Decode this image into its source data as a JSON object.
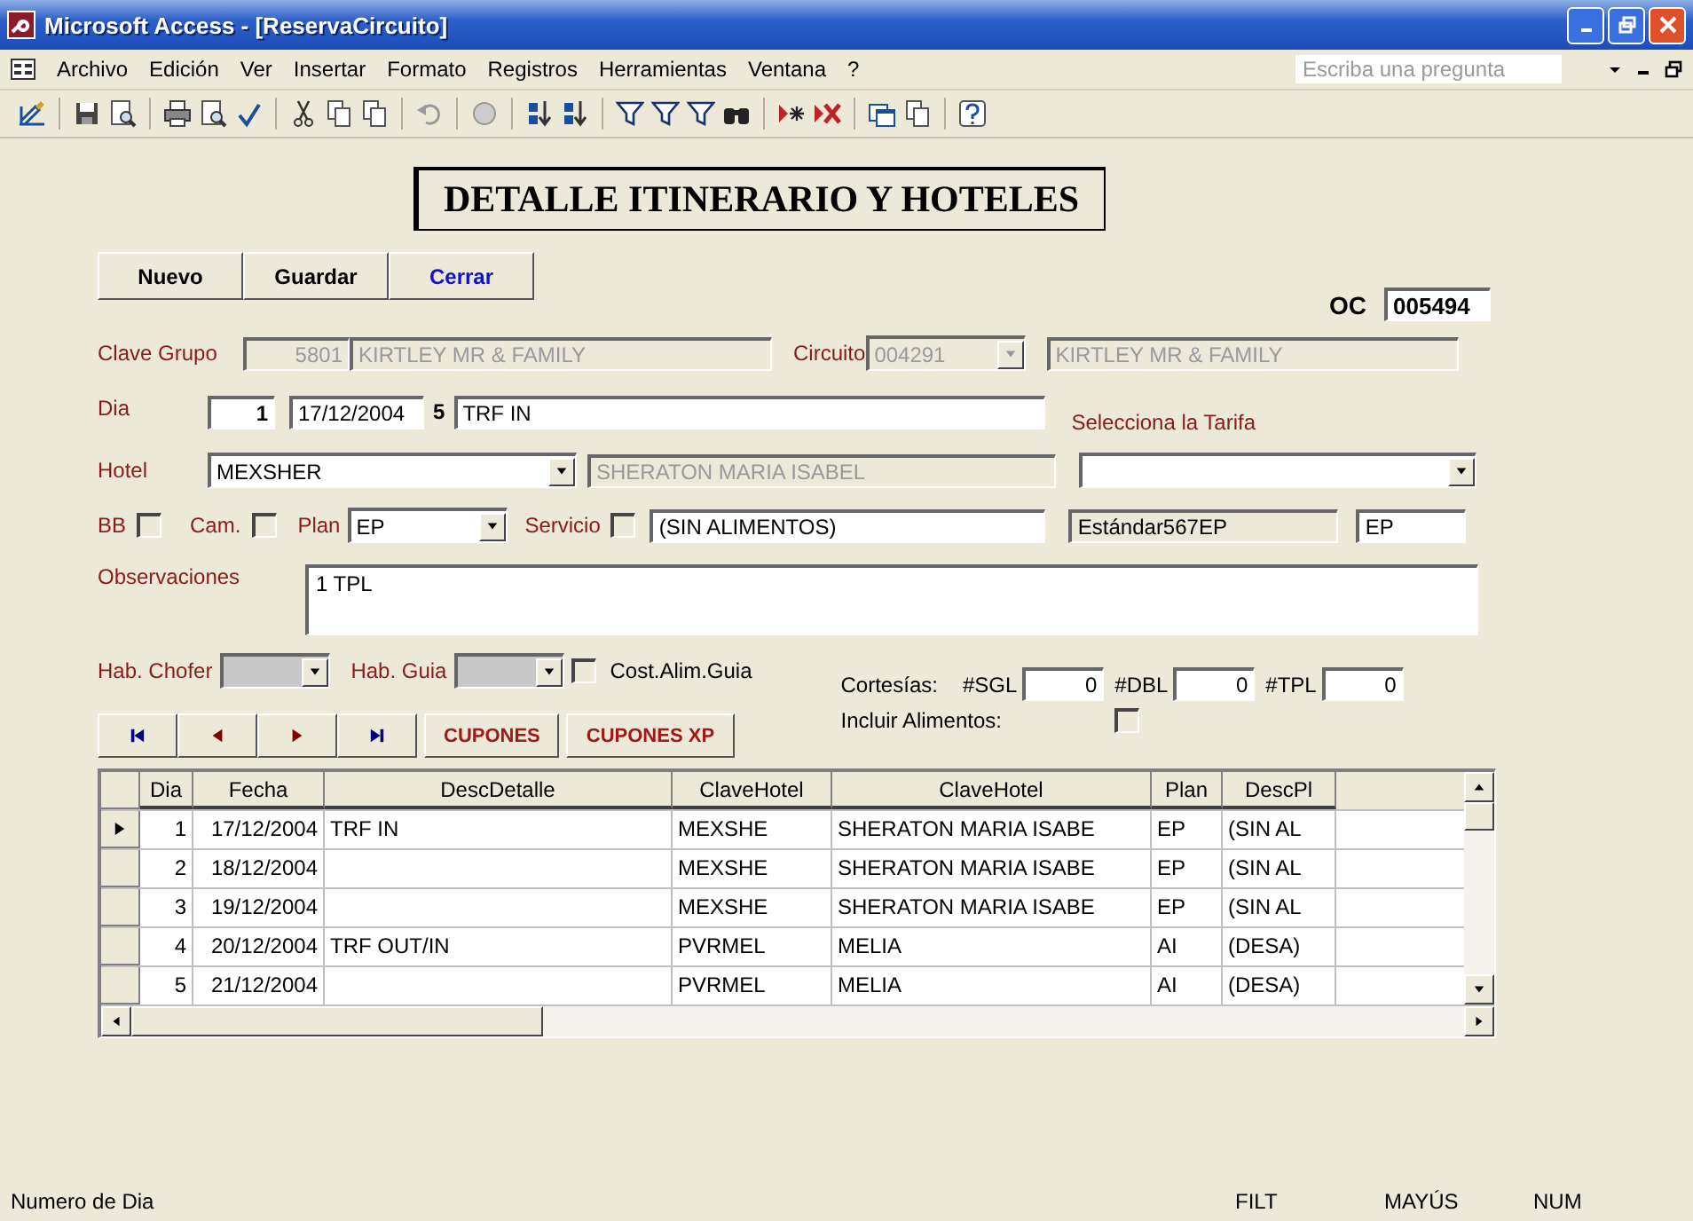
{
  "window": {
    "title": "Microsoft Access - [ReservaCircuito]"
  },
  "menu": [
    "Archivo",
    "Edición",
    "Ver",
    "Insertar",
    "Formato",
    "Registros",
    "Herramientas",
    "Ventana",
    "?"
  ],
  "help_search": {
    "placeholder": "Escriba una pregunta"
  },
  "form": {
    "heading": "DETALLE ITINERARIO Y HOTELES",
    "buttons": [
      "Nuevo",
      "Guardar",
      "Cerrar"
    ],
    "oc": {
      "label": "OC",
      "value": "005494"
    },
    "clave_grupo": {
      "label": "Clave Grupo",
      "code": "5801",
      "name": "KIRTLEY MR & FAMILY",
      "disabled": true
    },
    "circuito": {
      "label": "Circuito",
      "code": "004291",
      "name": "KIRTLEY MR & FAMILY",
      "disabled": true
    },
    "dia": {
      "label": "Dia",
      "number": "1",
      "date": "17/12/2004",
      "weekday": "5",
      "description": "TRF IN"
    },
    "tarifa_label": "Selecciona la Tarifa",
    "hotel": {
      "label": "Hotel",
      "code": "MEXSHER",
      "name": "SHERATON MARIA ISABEL",
      "disabled": true
    },
    "bb": {
      "label": "BB",
      "checked": false
    },
    "cam": {
      "label": "Cam.",
      "checked": false
    },
    "plan": {
      "label": "Plan",
      "value": "EP"
    },
    "servicio": {
      "label": "Servicio",
      "checked": false,
      "value": "(SIN ALIMENTOS)"
    },
    "tarifa_name": "Estándar567EP",
    "tarifa_plan": "EP",
    "observaciones": {
      "label": "Observaciones",
      "value": "1 TPL"
    },
    "hab_chofer": {
      "label": "Hab. Chofer"
    },
    "hab_guia": {
      "label": "Hab. Guia"
    },
    "cost_alim": {
      "label": "Cost.Alim.Guia",
      "checked": false
    },
    "cortesias": {
      "label": "Cortesías:",
      "items": [
        {
          "label": "#SGL",
          "value": "0"
        },
        {
          "label": "#DBL",
          "value": "0"
        },
        {
          "label": "#TPL",
          "value": "0"
        }
      ]
    },
    "incluir": {
      "label": "Incluir Alimentos:",
      "checked": false
    },
    "extra_buttons": [
      "CUPONES",
      "CUPONES XP"
    ]
  },
  "table": {
    "columns": [
      "Dia",
      "Fecha",
      "DescDetalle",
      "ClaveHotel",
      "ClaveHotel",
      "Plan",
      "DescPl"
    ],
    "rows": [
      {
        "selected": true,
        "cells": [
          "1",
          "17/12/2004",
          "TRF IN",
          "MEXSHE",
          "SHERATON MARIA ISABE",
          "EP",
          "(SIN AL"
        ]
      },
      {
        "selected": false,
        "cells": [
          "2",
          "18/12/2004",
          "",
          "MEXSHE",
          "SHERATON MARIA ISABE",
          "EP",
          "(SIN AL"
        ]
      },
      {
        "selected": false,
        "cells": [
          "3",
          "19/12/2004",
          "",
          "MEXSHE",
          "SHERATON MARIA ISABE",
          "EP",
          "(SIN AL"
        ]
      },
      {
        "selected": false,
        "cells": [
          "4",
          "20/12/2004",
          "TRF OUT/IN",
          "PVRMEL",
          "MELIA",
          "AI",
          "(DESA)"
        ]
      },
      {
        "selected": false,
        "cells": [
          "5",
          "21/12/2004",
          "",
          "PVRMEL",
          "MELIA",
          "AI",
          "(DESA)"
        ]
      }
    ]
  },
  "status_bar": {
    "message": "Numero de Dia",
    "indicators": [
      "FILT",
      "MAYÚS",
      "NUM"
    ]
  }
}
